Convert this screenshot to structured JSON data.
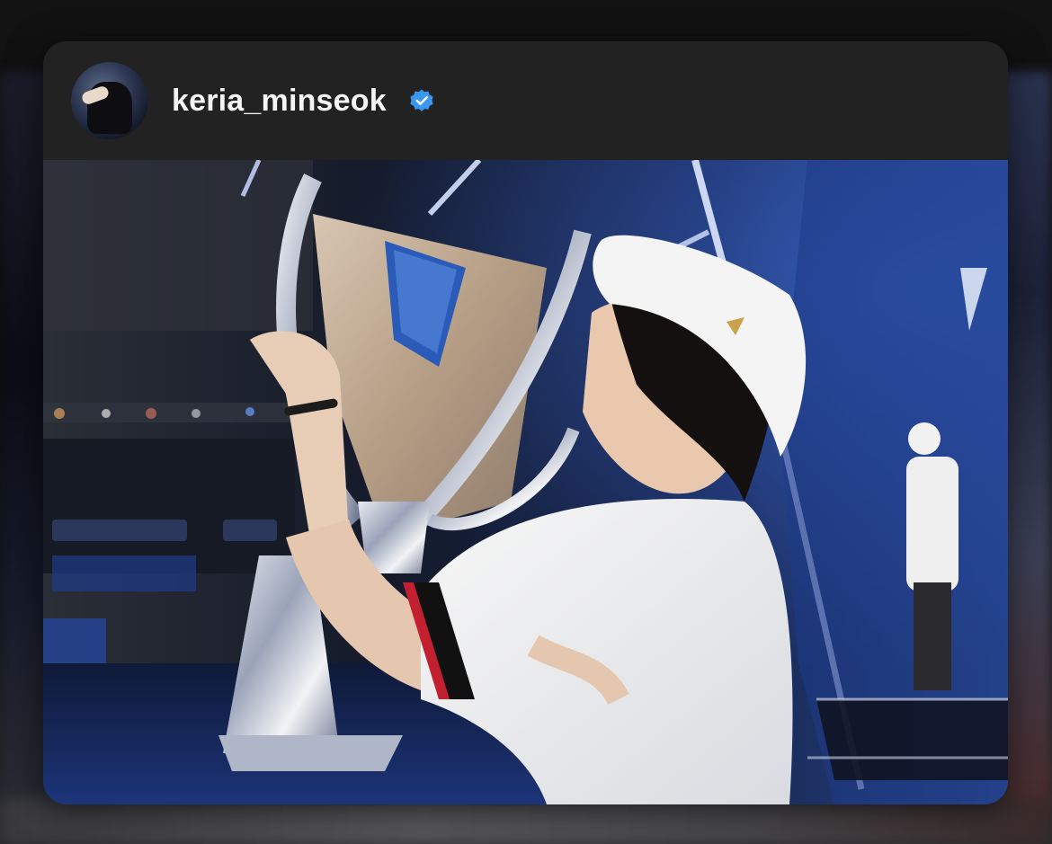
{
  "post": {
    "username": "keria_minseok",
    "verified": true
  },
  "icons": {
    "verified": "verified-badge-icon",
    "avatar": "profile-avatar"
  },
  "colors": {
    "verified_blue": "#3897f0",
    "header_bg": "#222222",
    "username_text": "#f5f5f5"
  }
}
